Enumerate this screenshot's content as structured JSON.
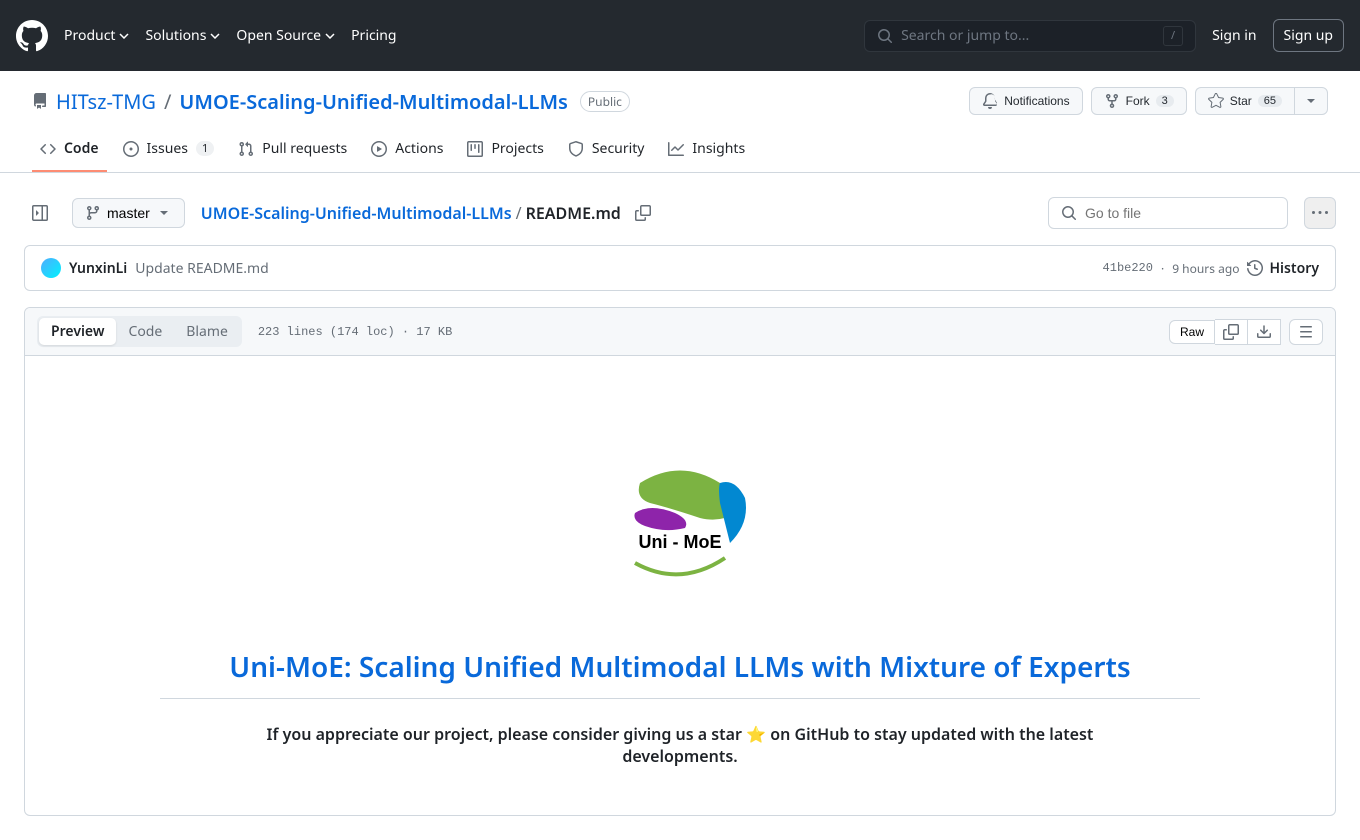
{
  "header": {
    "nav": [
      "Product",
      "Solutions",
      "Open Source",
      "Pricing"
    ],
    "search_placeholder": "Search or jump to...",
    "slash": "/",
    "signin": "Sign in",
    "signup": "Sign up"
  },
  "repo": {
    "owner": "HITsz-TMG",
    "name": "UMOE-Scaling-Unified-Multimodal-LLMs",
    "visibility": "Public",
    "actions": {
      "notifications": "Notifications",
      "fork": "Fork",
      "fork_count": "3",
      "star": "Star",
      "star_count": "65"
    }
  },
  "tabs": [
    {
      "label": "Code",
      "active": true
    },
    {
      "label": "Issues",
      "count": "1"
    },
    {
      "label": "Pull requests"
    },
    {
      "label": "Actions"
    },
    {
      "label": "Projects"
    },
    {
      "label": "Security"
    },
    {
      "label": "Insights"
    }
  ],
  "fileNav": {
    "branch": "master",
    "breadcrumb_root": "UMOE-Scaling-Unified-Multimodal-LLMs",
    "breadcrumb_file": "README.md",
    "gotofile_placeholder": "Go to file"
  },
  "commit": {
    "author": "YunxinLi",
    "message": "Update README.md",
    "sha": "41be220",
    "time": "9 hours ago",
    "history": "History"
  },
  "fileToolbar": {
    "preview": "Preview",
    "code": "Code",
    "blame": "Blame",
    "stats": "223 lines (174 loc) · 17 KB",
    "raw": "Raw"
  },
  "readme": {
    "logo_text": "Uni - MoE",
    "title": "Uni-MoE: Scaling Unified Multimodal LLMs with Mixture of Experts",
    "subtitle": "If you appreciate our project, please consider giving us a star ⭐ on GitHub to stay updated with the latest developments."
  }
}
